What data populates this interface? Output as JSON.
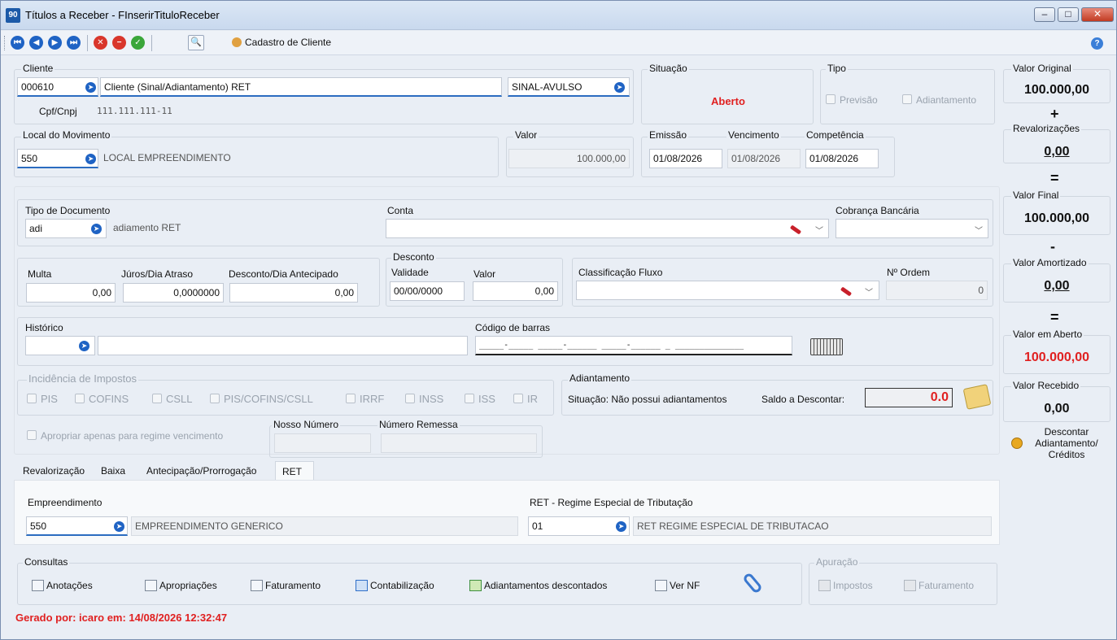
{
  "window": {
    "title": "Títulos a Receber - FInserirTituloReceber",
    "app_icon": "90",
    "minimize": "–",
    "maximize": "□",
    "close": "✕"
  },
  "toolbar": {
    "cadastro_cliente": "Cadastro de Cliente"
  },
  "cliente": {
    "label": "Cliente",
    "code": "000610",
    "name": "Cliente (Sinal/Adiantamento) RET",
    "tipo_cliente": "SINAL-AVULSO",
    "cpf_label": "Cpf/Cnpj",
    "cpf_value": "111.111.111-11"
  },
  "situacao": {
    "label": "Situação",
    "value": "Aberto",
    "color": "#e02020"
  },
  "tipo": {
    "label": "Tipo",
    "previsao": "Previsão",
    "adiantamento": "Adiantamento"
  },
  "local": {
    "label": "Local do Movimento",
    "code": "550",
    "name": "LOCAL EMPREENDIMENTO"
  },
  "valor": {
    "label": "Valor",
    "value": "100.000,00"
  },
  "datas": {
    "emissao_label": "Emissão",
    "emissao": "01/08/2026",
    "vencimento_label": "Vencimento",
    "vencimento": "01/08/2026",
    "competencia_label": "Competência",
    "competencia": "01/08/2026"
  },
  "documento": {
    "tipo_label": "Tipo de Documento",
    "tipo_code": "adi",
    "tipo_name": "adiamento RET",
    "conta_label": "Conta",
    "conta_value": "",
    "cobranca_label": "Cobrança Bancária",
    "cobranca_value": ""
  },
  "encargos": {
    "multa_label": "Multa",
    "multa": "0,00",
    "juros_label": "Júros/Dia Atraso",
    "juros": "0,0000000",
    "desc_dia_label": "Desconto/Dia Antecipado",
    "desc_dia": "0,00"
  },
  "desconto": {
    "label": "Desconto",
    "validade_label": "Validade",
    "validade": "00/00/0000",
    "valor_label": "Valor",
    "valor": "0,00"
  },
  "fluxo": {
    "label": "Classificação Fluxo",
    "value": "",
    "ordem_label": "Nº Ordem",
    "ordem": "0"
  },
  "historico": {
    "label": "Histórico",
    "code": "",
    "text": ""
  },
  "barras": {
    "label": "Código de barras",
    "mask": "_____-_____ _____-______ _____-______ _ ______________"
  },
  "impostos": {
    "label": "Incidência de Impostos",
    "items": [
      "PIS",
      "COFINS",
      "CSLL",
      "PIS/COFINS/CSLL",
      "IRRF",
      "INSS",
      "ISS",
      "IR"
    ]
  },
  "adiantamento": {
    "label": "Adiantamento",
    "situacao": "Situação: Não possui adiantamentos",
    "saldo_label": "Saldo a Descontar:",
    "saldo": "0.0"
  },
  "apropriar": {
    "label": "Apropriar apenas para regime vencimento"
  },
  "nosso_numero": {
    "label": "Nosso Número",
    "value": ""
  },
  "numero_remessa": {
    "label": "Número Remessa",
    "value": ""
  },
  "tabs": [
    {
      "label": "Revalorização"
    },
    {
      "label": "Baixa"
    },
    {
      "label": "Antecipação/Prorrogação"
    },
    {
      "label": "RET"
    }
  ],
  "ret": {
    "emp_label": "Empreendimento",
    "emp_code": "550",
    "emp_name": "EMPREENDIMENTO GENERICO",
    "regime_label": "RET - Regime Especial de Tributação",
    "regime_code": "01",
    "regime_name": "RET REGIME ESPECIAL DE TRIBUTACAO"
  },
  "consultas": {
    "label": "Consultas",
    "items": [
      "Anotações",
      "Apropriações",
      "Faturamento",
      "Contabilização",
      "Adiantamentos descontados",
      "Ver NF"
    ]
  },
  "apuracao": {
    "label": "Apuração",
    "impostos": "Impostos",
    "faturamento": "Faturamento"
  },
  "resumo": {
    "valor_original_label": "Valor Original",
    "valor_original": "100.000,00",
    "plus": "+",
    "revalorizacoes_label": "Revalorizações",
    "revalorizacoes": "0,00",
    "eq1": "=",
    "valor_final_label": "Valor Final",
    "valor_final": "100.000,00",
    "minus": "-",
    "valor_amortizado_label": "Valor Amortizado",
    "valor_amortizado": "0,00",
    "eq2": "=",
    "valor_aberto_label": "Valor em Aberto",
    "valor_aberto": "100.000,00",
    "valor_recebido_label": "Valor Recebido",
    "valor_recebido": "0,00",
    "descontar": "Descontar Adiantamento/ Créditos"
  },
  "footer": {
    "gerado": "Gerado por: icaro em: 14/08/2026 12:32:47"
  }
}
